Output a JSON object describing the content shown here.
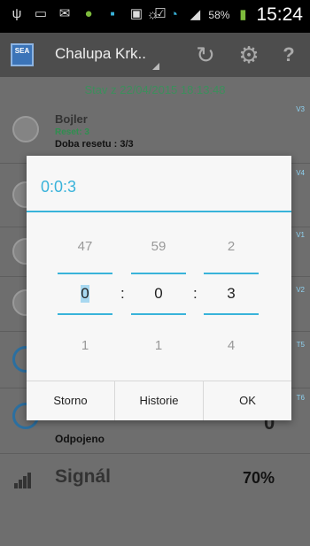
{
  "statusbar": {
    "icons": [
      "usb-icon",
      "image-icon",
      "mail-icon",
      "android-icon",
      "dot-icon",
      "nfc-icon",
      "clipboard-icon",
      "vibrate-icon",
      "wifi-icon",
      "signal-icon"
    ],
    "battery": "58%",
    "time": "15:24"
  },
  "actionbar": {
    "title": "Chalupa Krk..",
    "logo": "SEA",
    "refresh_icon": "refresh-icon",
    "settings_icon": "gear-icon",
    "help": "?"
  },
  "content": {
    "state": "Stav z 22/04/2015 18:13:48",
    "row1": {
      "title": "Bojler",
      "sub1": "Reset: 3",
      "sub2": "Doba resetu : 3/3",
      "tag": "V3"
    },
    "tags": [
      "V4",
      "V1",
      "V2",
      "T5",
      "T6"
    ],
    "odpojeno": "Odpojeno",
    "zero": "0",
    "signal": {
      "label": "Signál",
      "value": "70%"
    }
  },
  "dialog": {
    "title": "0:0:3",
    "columns": [
      {
        "prev": "47",
        "current": "0",
        "next": "1"
      },
      {
        "prev": "59",
        "current": "0",
        "next": "1"
      },
      {
        "prev": "2",
        "current": "3",
        "next": "4"
      }
    ],
    "separator": ":",
    "buttons": {
      "cancel": "Storno",
      "history": "Historie",
      "ok": "OK"
    }
  },
  "colors": {
    "accent": "#39b3da",
    "green": "#2f8f4f",
    "dim": "#6e6e6e"
  }
}
